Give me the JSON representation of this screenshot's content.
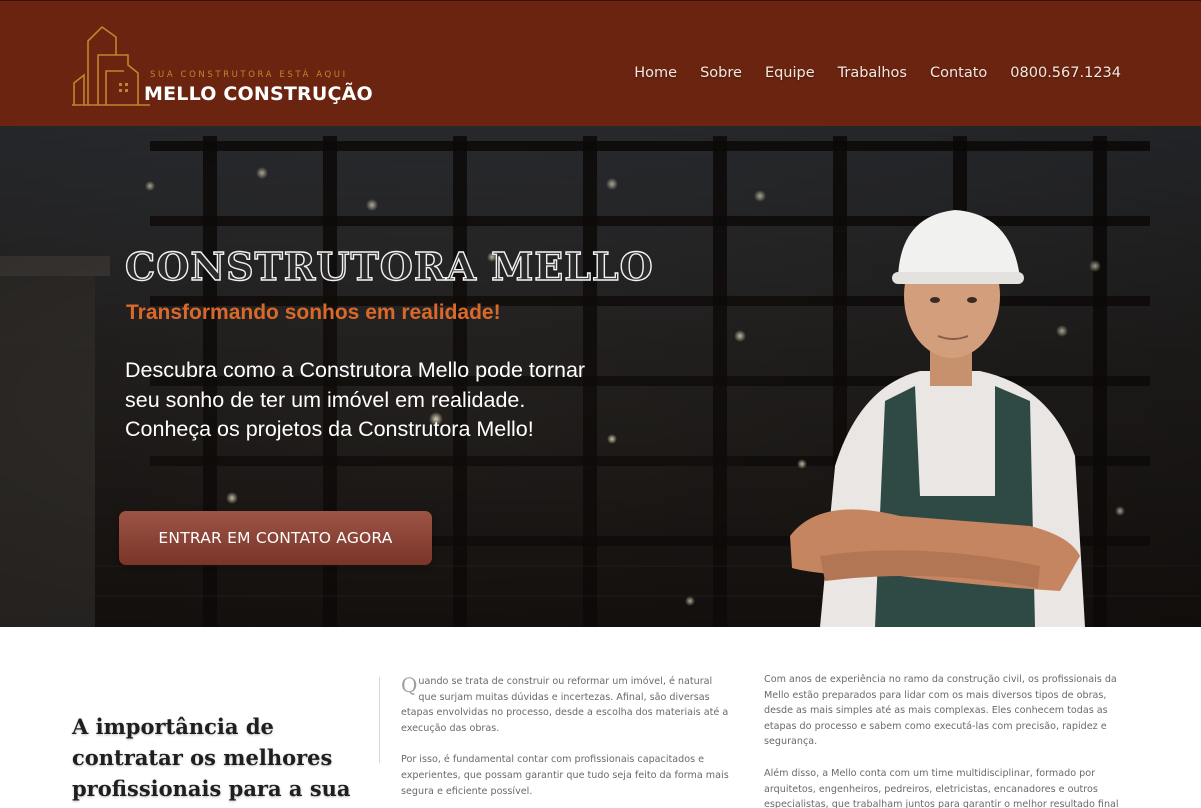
{
  "header": {
    "logo": {
      "tagline": "SUA CONSTRUTORA ESTÁ AQUI",
      "name": "MELLO CONSTRUÇÃO",
      "icon": "building-logo-icon"
    },
    "nav": [
      {
        "label": "Home"
      },
      {
        "label": "Sobre"
      },
      {
        "label": "Equipe"
      },
      {
        "label": "Trabalhos"
      },
      {
        "label": "Contato"
      },
      {
        "label": "0800.567.1234"
      }
    ]
  },
  "hero": {
    "title": "CONSTRUTORA MELLO",
    "subtitle": "Transformando sonhos em realidade!",
    "description_line1": "Descubra como a Construtora Mello pode tornar seu sonho de ter um imóvel em realidade.",
    "description_line2": "Conheça os projetos da Construtora Mello!",
    "cta_label": "ENTRAR EM CONTATO AGORA"
  },
  "about": {
    "title": "A importância de contratar os melhores profissionais para a sua obra",
    "col1_dropcap": "Q",
    "col1_p1": "uando se trata de construir ou reformar um imóvel, é natural que surjam muitas dúvidas e incertezas. Afinal, são diversas etapas envolvidas no processo, desde a escolha dos materiais até a execução das obras.",
    "col1_p2": "Por isso, é fundamental contar com profissionais capacitados e experientes, que possam garantir que tudo seja feito da forma mais segura e eficiente possível.",
    "col2_p1": "Com anos de experiência no ramo da construção civil, os profissionais da Mello estão preparados para lidar com os mais diversos tipos de obras, desde as mais simples até as mais complexas. Eles conhecem todas as etapas do processo e sabem como executá-las com precisão, rapidez e segurança.",
    "col2_p2": "Além disso, a Mello conta com um time multidisciplinar, formado por arquitetos, engenheiros, pedreiros, eletricistas, encanadores e outros especialistas, que trabalham juntos para garantir o melhor resultado final para os clientes."
  },
  "colors": {
    "header_bg": "#6b2410",
    "accent_orange": "#d9692a",
    "logo_gold": "#c7822f",
    "cta_bg": "#8a4436"
  }
}
